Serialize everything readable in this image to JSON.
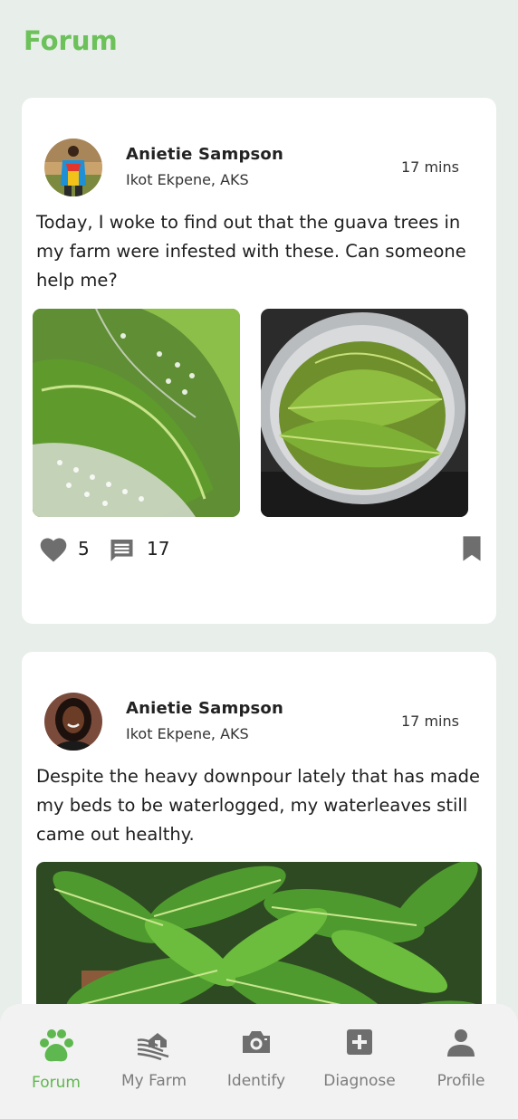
{
  "header": {
    "title": "Forum"
  },
  "posts": [
    {
      "author": "Anietie Sampson",
      "location": "Ikot Ekpene, AKS",
      "time": "17 mins",
      "text": "Today, I woke to find out that the guava trees in my farm were infested with these. Can someone help me?",
      "images": [
        "infested-guava-leaf-photo",
        "guava-leaves-in-pot-photo"
      ],
      "likes": "5",
      "comments": "17"
    },
    {
      "author": "Anietie Sampson",
      "location": "Ikot Ekpene, AKS",
      "time": "17 mins",
      "text": "Despite the heavy downpour lately that has made my beds to be waterlogged, my waterleaves still came out healthy.",
      "images": [
        "waterleaf-bunch-photo"
      ]
    }
  ],
  "nav": {
    "items": [
      {
        "label": "Forum",
        "icon": "paw-icon",
        "active": true
      },
      {
        "label": "My Farm",
        "icon": "farm-icon",
        "active": false
      },
      {
        "label": "Identify",
        "icon": "camera-icon",
        "active": false
      },
      {
        "label": "Diagnose",
        "icon": "plus-box-icon",
        "active": false
      },
      {
        "label": "Profile",
        "icon": "person-icon",
        "active": false
      }
    ]
  },
  "colors": {
    "accent": "#6cc15a",
    "nav_active": "#5fb84f",
    "icon_gray": "#6e6e6e",
    "background": "#e8eee9"
  }
}
